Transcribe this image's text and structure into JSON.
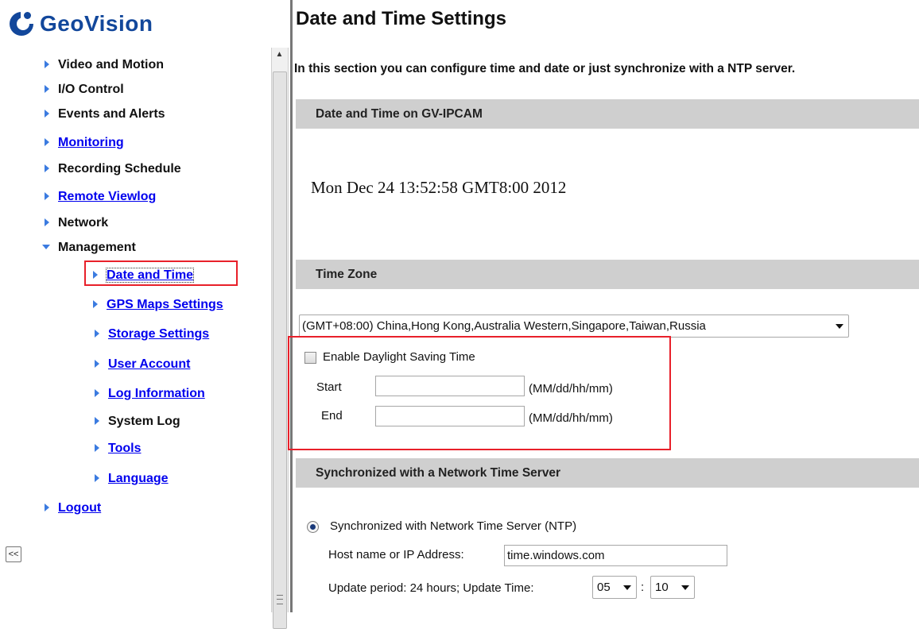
{
  "brand": {
    "logo_text": "GeoVision"
  },
  "sidebar": {
    "items": [
      {
        "label": "Video and Motion",
        "link": false
      },
      {
        "label": "I/O Control",
        "link": false
      },
      {
        "label": "Events and Alerts",
        "link": false
      },
      {
        "label": "Monitoring",
        "link": true
      },
      {
        "label": "Recording Schedule",
        "link": false
      },
      {
        "label": "Remote Viewlog",
        "link": true
      },
      {
        "label": "Network",
        "link": false
      },
      {
        "label": "Management",
        "link": false,
        "expanded": true
      },
      {
        "label": "Date and Time",
        "link": true,
        "selected": true
      },
      {
        "label": "GPS Maps Settings",
        "link": true
      },
      {
        "label": "Storage Settings",
        "link": true
      },
      {
        "label": "User Account",
        "link": true
      },
      {
        "label": "Log Information",
        "link": true
      },
      {
        "label": "System Log",
        "link": false
      },
      {
        "label": "Tools",
        "link": true
      },
      {
        "label": "Language",
        "link": true
      },
      {
        "label": "Logout",
        "link": true
      }
    ],
    "collapse_label": "<<"
  },
  "main": {
    "title": "Date and Time Settings",
    "intro": "In this section you can configure time and date or just synchronize with a NTP server.",
    "section_current": "Date and Time on GV-IPCAM",
    "current_datetime": "Mon Dec 24 13:52:58 GMT8:00 2012",
    "section_timezone": "Time Zone",
    "timezone_value": "(GMT+08:00) China,Hong Kong,Australia Western,Singapore,Taiwan,Russia",
    "dst_label": "Enable Daylight Saving Time",
    "dst_checked": false,
    "start_label": "Start",
    "end_label": "End",
    "start_value": "",
    "end_value": "",
    "date_format_hint": "(MM/dd/hh/mm)",
    "section_ntp": "Synchronized with a Network Time Server",
    "ntp_option_label": "Synchronized with Network Time Server (NTP)",
    "host_label": "Host name or IP Address:",
    "host_value": "time.windows.com",
    "update_label": "Update period: 24 hours; Update Time:",
    "update_hour": "05",
    "update_minute": "10",
    "time_separator": ":"
  },
  "colors": {
    "accent": "#12479b",
    "link": "#0000ee",
    "highlight": "#e8202a",
    "section_bar": "#cfcfcf"
  }
}
